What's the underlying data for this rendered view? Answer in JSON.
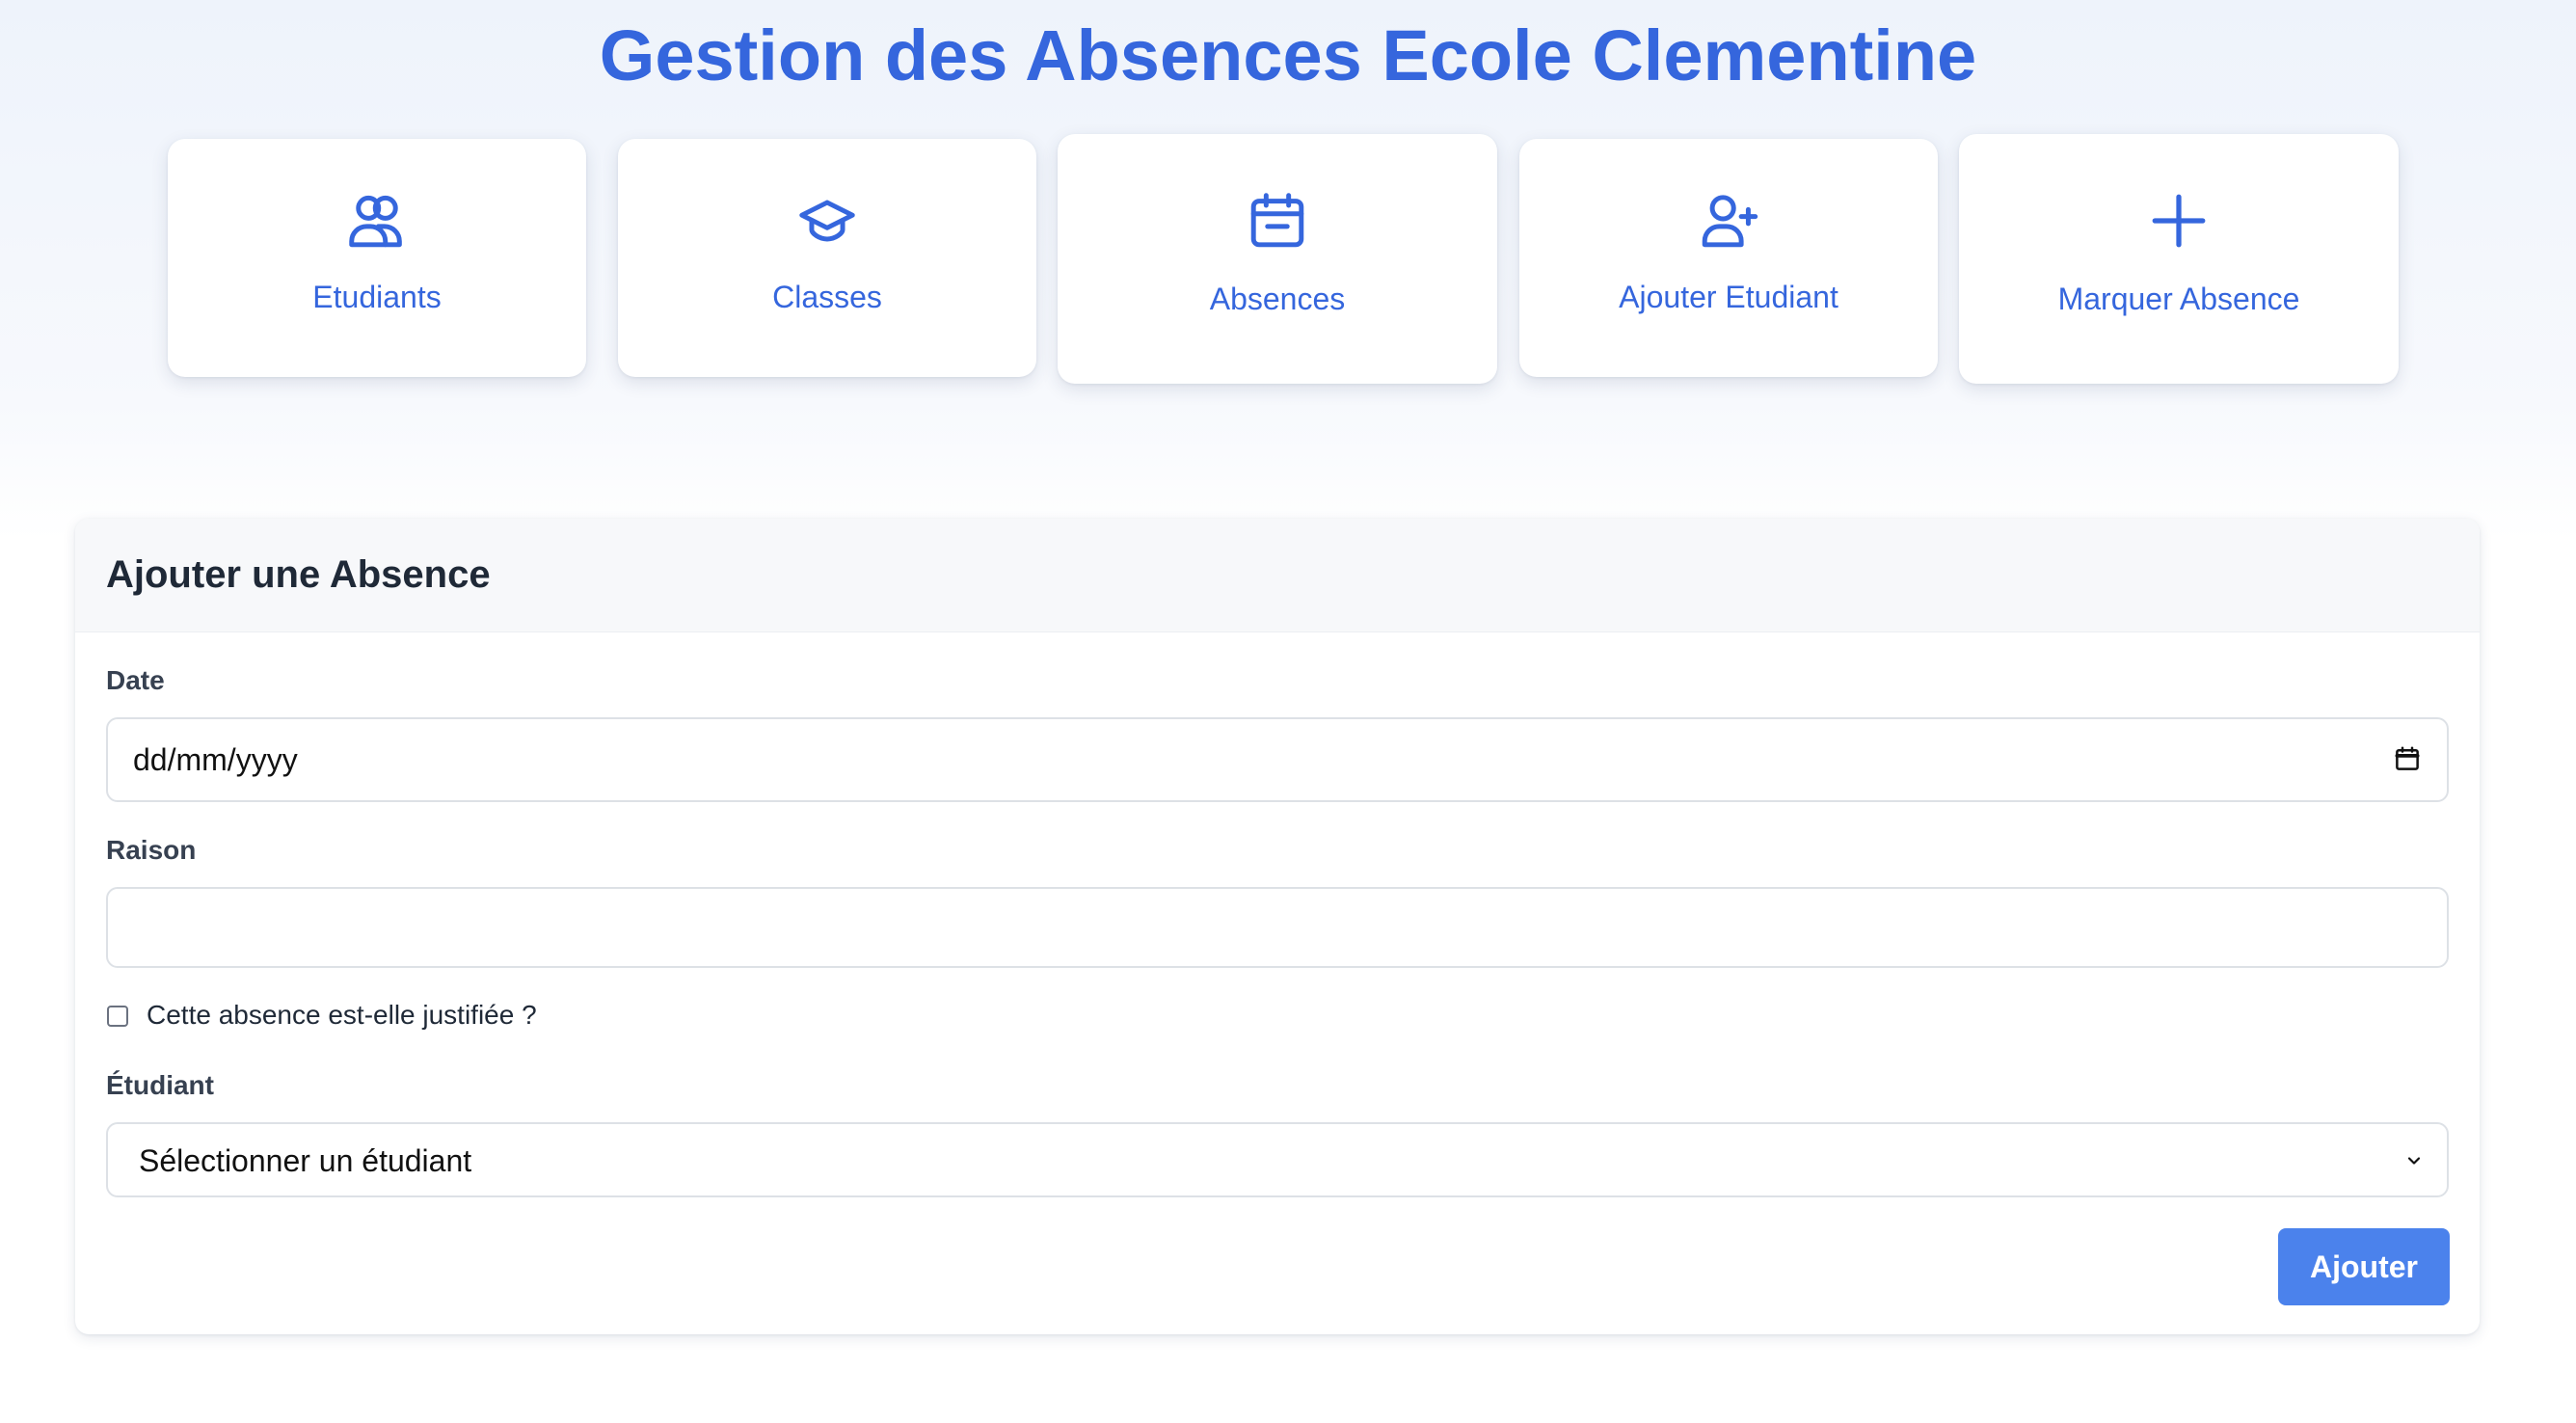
{
  "header": {
    "title": "Gestion des Absences Ecole Clementine"
  },
  "nav": {
    "items": [
      {
        "label": "Etudiants",
        "icon": "users-icon"
      },
      {
        "label": "Classes",
        "icon": "graduation-cap-icon"
      },
      {
        "label": "Absences",
        "icon": "calendar-icon"
      },
      {
        "label": "Ajouter Etudiant",
        "icon": "user-plus-icon"
      },
      {
        "label": "Marquer Absence",
        "icon": "plus-icon"
      }
    ]
  },
  "form": {
    "title": "Ajouter une Absence",
    "date": {
      "label": "Date",
      "placeholder": "dd/mm/yyyy",
      "value": ""
    },
    "raison": {
      "label": "Raison",
      "value": ""
    },
    "justified": {
      "label": "Cette absence est-elle justifiée ?",
      "checked": false
    },
    "etudiant": {
      "label": "Étudiant",
      "selected": "Sélectionner un étudiant"
    },
    "submit_label": "Ajouter"
  },
  "colors": {
    "accent": "#3566dd",
    "button": "#4b82ec",
    "header_bg": "#f7f8fa",
    "border": "#dde1e6"
  }
}
